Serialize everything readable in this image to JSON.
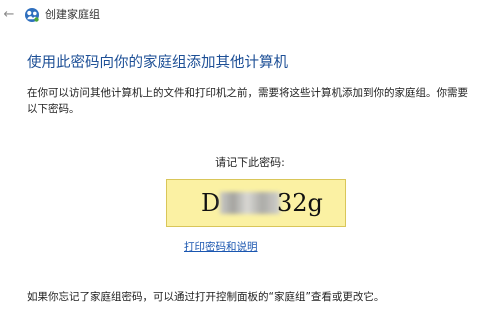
{
  "window": {
    "title": "创建家庭组",
    "back_icon": "back-arrow-icon",
    "app_icon": "homegroup-icon"
  },
  "page": {
    "heading": "使用此密码向你的家庭组添加其他计算机",
    "description": "在你可以访问其他计算机上的文件和打印机之前，需要将这些计算机添加到你的家庭组。你需要以下密码。"
  },
  "password": {
    "label": "请记下此密码:",
    "visible_start": "D",
    "visible_end": "32g",
    "background_color": "#fbf1a3"
  },
  "actions": {
    "print_link": "打印密码和说明"
  },
  "footer": {
    "note": "如果你忘记了家庭组密码，可以通过打开控制面板的“家庭组”查看或更改它。"
  }
}
